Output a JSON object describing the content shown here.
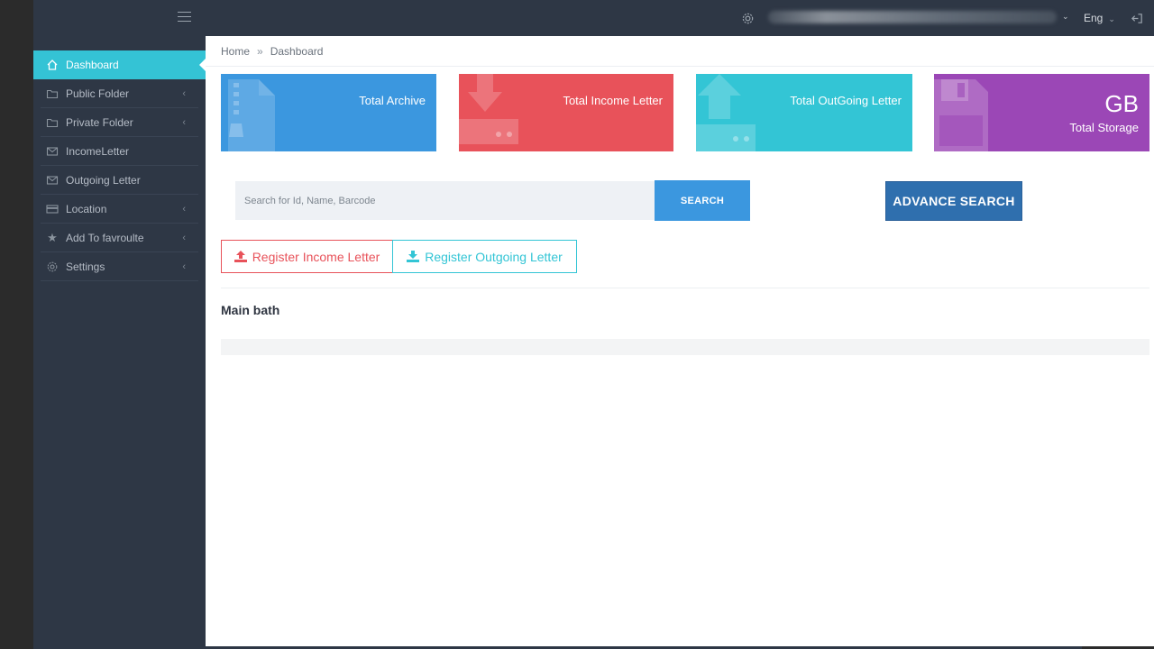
{
  "topbar": {
    "user_email": "",
    "language": "Eng"
  },
  "sidebar": {
    "items": [
      {
        "label": "Dashboard",
        "icon": "home-icon",
        "active": true
      },
      {
        "label": "Public Folder",
        "icon": "folder-icon"
      },
      {
        "label": "Private Folder",
        "icon": "folder-icon"
      },
      {
        "label": "IncomeLetter",
        "icon": "envelope-icon"
      },
      {
        "label": "Outgoing Letter",
        "icon": "envelope-icon"
      },
      {
        "label": "Location",
        "icon": "card-icon"
      },
      {
        "label": "Add To favroulte",
        "icon": "star-icon"
      },
      {
        "label": "Settings",
        "icon": "gear-icon"
      }
    ]
  },
  "breadcrumb": {
    "home": "Home",
    "separator": "»",
    "current": "Dashboard"
  },
  "cards": {
    "total_archive": {
      "label": "Total Archive",
      "color": "#3b97df",
      "icon": "zip-file-icon"
    },
    "total_income": {
      "label": "Total Income Letter",
      "color": "#e8525a",
      "icon": "inbox-download-icon"
    },
    "total_outgoing": {
      "label": "Total OutGoing Letter",
      "color": "#33c5d5",
      "icon": "upload-icon"
    },
    "total_storage": {
      "value": "GB",
      "label": "Total Storage",
      "color": "#9b47b6",
      "icon": "floppy-disk-icon"
    }
  },
  "search": {
    "placeholder": "Search for Id, Name, Barcode",
    "button": "SEARCH",
    "advance_button": "ADVANCE SEARCH"
  },
  "register": {
    "income": "Register Income Letter",
    "outgoing": "Register Outgoing Letter"
  },
  "section": {
    "title": "Main bath"
  }
}
